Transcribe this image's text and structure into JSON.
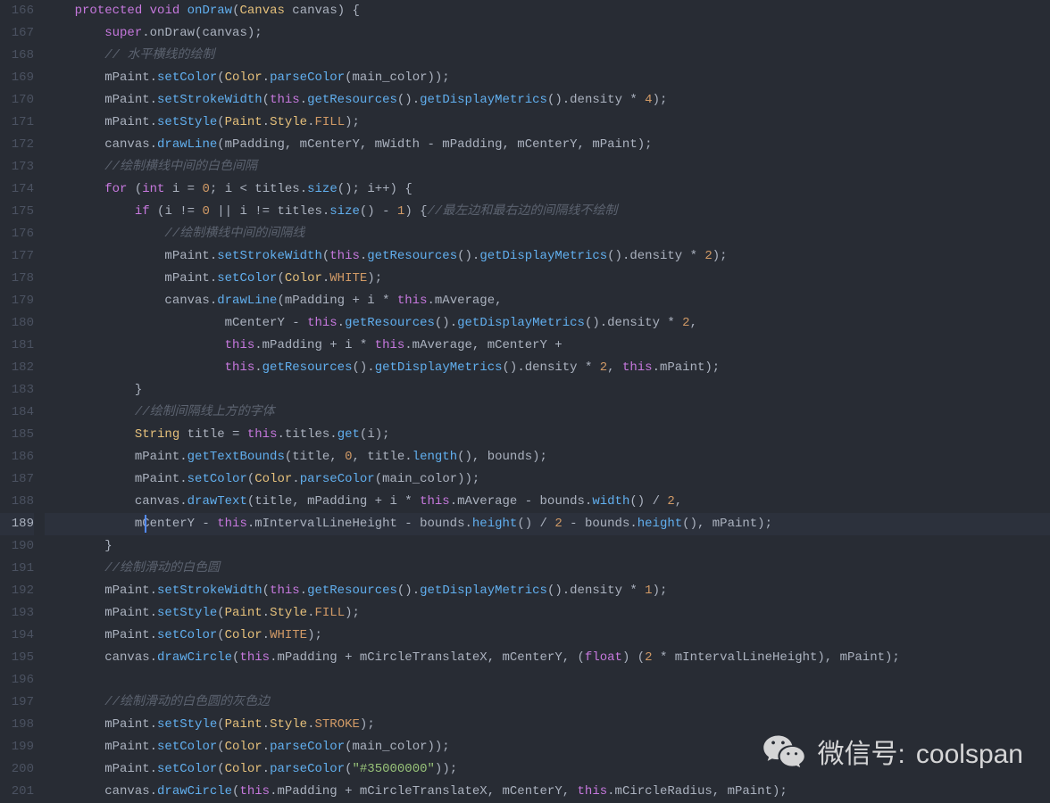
{
  "gutter": {
    "start": 166,
    "end": 201,
    "highlighted": 189
  },
  "code": {
    "lines": [
      [
        [
          "    ",
          ""
        ],
        [
          "protected",
          "kw"
        ],
        [
          " ",
          ""
        ],
        [
          "void",
          "kw"
        ],
        [
          " ",
          ""
        ],
        [
          "onDraw",
          "fn"
        ],
        [
          "(",
          ""
        ],
        [
          "Canvas",
          "type"
        ],
        [
          " canvas) {",
          ""
        ]
      ],
      [
        [
          "        ",
          ""
        ],
        [
          "super",
          "kw"
        ],
        [
          ".onDraw(canvas);",
          ""
        ]
      ],
      [
        [
          "        ",
          ""
        ],
        [
          "// 水平横线的绘制",
          "cm"
        ]
      ],
      [
        [
          "        mPaint.",
          ""
        ],
        [
          "setColor",
          "fn"
        ],
        [
          "(",
          ""
        ],
        [
          "Color",
          "type"
        ],
        [
          ".",
          ""
        ],
        [
          "parseColor",
          "fn"
        ],
        [
          "(main_color));",
          ""
        ]
      ],
      [
        [
          "        mPaint.",
          ""
        ],
        [
          "setStrokeWidth",
          "fn"
        ],
        [
          "(",
          ""
        ],
        [
          "this",
          "kw"
        ],
        [
          ".",
          ""
        ],
        [
          "getResources",
          "fn"
        ],
        [
          "().",
          ""
        ],
        [
          "getDisplayMetrics",
          "fn"
        ],
        [
          "().density * ",
          ""
        ],
        [
          "4",
          "num"
        ],
        [
          ");",
          ""
        ]
      ],
      [
        [
          "        mPaint.",
          ""
        ],
        [
          "setStyle",
          "fn"
        ],
        [
          "(",
          ""
        ],
        [
          "Paint",
          "type"
        ],
        [
          ".",
          ""
        ],
        [
          "Style",
          "type"
        ],
        [
          ".",
          ""
        ],
        [
          "FILL",
          "const"
        ],
        [
          ");",
          ""
        ]
      ],
      [
        [
          "        canvas.",
          ""
        ],
        [
          "drawLine",
          "fn"
        ],
        [
          "(mPadding, mCenterY, mWidth - mPadding, mCenterY, mPaint);",
          ""
        ]
      ],
      [
        [
          "        ",
          ""
        ],
        [
          "//绘制横线中间的白色间隔",
          "cm"
        ]
      ],
      [
        [
          "        ",
          ""
        ],
        [
          "for",
          "kw"
        ],
        [
          " (",
          ""
        ],
        [
          "int",
          "kw"
        ],
        [
          " i = ",
          ""
        ],
        [
          "0",
          "num"
        ],
        [
          "; i < titles.",
          ""
        ],
        [
          "size",
          "fn"
        ],
        [
          "(); i++) {",
          ""
        ]
      ],
      [
        [
          "            ",
          ""
        ],
        [
          "if",
          "kw"
        ],
        [
          " (i != ",
          ""
        ],
        [
          "0",
          "num"
        ],
        [
          " || i != titles.",
          ""
        ],
        [
          "size",
          "fn"
        ],
        [
          "() - ",
          ""
        ],
        [
          "1",
          "num"
        ],
        [
          ") {",
          ""
        ],
        [
          "//最左边和最右边的间隔线不绘制",
          "cm"
        ]
      ],
      [
        [
          "                ",
          ""
        ],
        [
          "//绘制横线中间的间隔线",
          "cm"
        ]
      ],
      [
        [
          "                mPaint.",
          ""
        ],
        [
          "setStrokeWidth",
          "fn"
        ],
        [
          "(",
          ""
        ],
        [
          "this",
          "kw"
        ],
        [
          ".",
          ""
        ],
        [
          "getResources",
          "fn"
        ],
        [
          "().",
          ""
        ],
        [
          "getDisplayMetrics",
          "fn"
        ],
        [
          "().density * ",
          ""
        ],
        [
          "2",
          "num"
        ],
        [
          ");",
          ""
        ]
      ],
      [
        [
          "                mPaint.",
          ""
        ],
        [
          "setColor",
          "fn"
        ],
        [
          "(",
          ""
        ],
        [
          "Color",
          "type"
        ],
        [
          ".",
          ""
        ],
        [
          "WHITE",
          "const"
        ],
        [
          ");",
          ""
        ]
      ],
      [
        [
          "                canvas.",
          ""
        ],
        [
          "drawLine",
          "fn"
        ],
        [
          "(mPadding + i * ",
          ""
        ],
        [
          "this",
          "kw"
        ],
        [
          ".mAverage,",
          ""
        ]
      ],
      [
        [
          "                        mCenterY - ",
          ""
        ],
        [
          "this",
          "kw"
        ],
        [
          ".",
          ""
        ],
        [
          "getResources",
          "fn"
        ],
        [
          "().",
          ""
        ],
        [
          "getDisplayMetrics",
          "fn"
        ],
        [
          "().density * ",
          ""
        ],
        [
          "2",
          "num"
        ],
        [
          ",",
          ""
        ]
      ],
      [
        [
          "                        ",
          ""
        ],
        [
          "this",
          "kw"
        ],
        [
          ".mPadding + i * ",
          ""
        ],
        [
          "this",
          "kw"
        ],
        [
          ".mAverage, mCenterY +",
          ""
        ]
      ],
      [
        [
          "                        ",
          ""
        ],
        [
          "this",
          "kw"
        ],
        [
          ".",
          ""
        ],
        [
          "getResources",
          "fn"
        ],
        [
          "().",
          ""
        ],
        [
          "getDisplayMetrics",
          "fn"
        ],
        [
          "().density * ",
          ""
        ],
        [
          "2",
          "num"
        ],
        [
          ", ",
          ""
        ],
        [
          "this",
          "kw"
        ],
        [
          ".mPaint);",
          ""
        ]
      ],
      [
        [
          "            }",
          ""
        ]
      ],
      [
        [
          "            ",
          ""
        ],
        [
          "//绘制间隔线上方的字体",
          "cm"
        ]
      ],
      [
        [
          "            ",
          ""
        ],
        [
          "String",
          "type"
        ],
        [
          " title = ",
          ""
        ],
        [
          "this",
          "kw"
        ],
        [
          ".titles.",
          ""
        ],
        [
          "get",
          "fn"
        ],
        [
          "(i);",
          ""
        ]
      ],
      [
        [
          "            mPaint.",
          ""
        ],
        [
          "getTextBounds",
          "fn"
        ],
        [
          "(title, ",
          ""
        ],
        [
          "0",
          "num"
        ],
        [
          ", title.",
          ""
        ],
        [
          "length",
          "fn"
        ],
        [
          "(), bounds);",
          ""
        ]
      ],
      [
        [
          "            mPaint.",
          ""
        ],
        [
          "setColor",
          "fn"
        ],
        [
          "(",
          ""
        ],
        [
          "Color",
          "type"
        ],
        [
          ".",
          ""
        ],
        [
          "parseColor",
          "fn"
        ],
        [
          "(main_color));",
          ""
        ]
      ],
      [
        [
          "            canvas.",
          ""
        ],
        [
          "drawText",
          "fn"
        ],
        [
          "(title, mPadding + i * ",
          ""
        ],
        [
          "this",
          "kw"
        ],
        [
          ".mAverage - bounds.",
          ""
        ],
        [
          "width",
          "fn"
        ],
        [
          "() / ",
          ""
        ],
        [
          "2",
          "num"
        ],
        [
          ",",
          ""
        ]
      ],
      [
        [
          "            mCenterY - ",
          ""
        ],
        [
          "this",
          "kw"
        ],
        [
          ".mIntervalLineHeight - bounds.",
          ""
        ],
        [
          "height",
          "fn"
        ],
        [
          "() / ",
          ""
        ],
        [
          "2",
          "num"
        ],
        [
          " - bounds.",
          ""
        ],
        [
          "height",
          "fn"
        ],
        [
          "(), mPaint);",
          ""
        ]
      ],
      [
        [
          "        }",
          ""
        ]
      ],
      [
        [
          "        ",
          ""
        ],
        [
          "//绘制滑动的白色圆",
          "cm"
        ]
      ],
      [
        [
          "        mPaint.",
          ""
        ],
        [
          "setStrokeWidth",
          "fn"
        ],
        [
          "(",
          ""
        ],
        [
          "this",
          "kw"
        ],
        [
          ".",
          ""
        ],
        [
          "getResources",
          "fn"
        ],
        [
          "().",
          ""
        ],
        [
          "getDisplayMetrics",
          "fn"
        ],
        [
          "().density * ",
          ""
        ],
        [
          "1",
          "num"
        ],
        [
          ");",
          ""
        ]
      ],
      [
        [
          "        mPaint.",
          ""
        ],
        [
          "setStyle",
          "fn"
        ],
        [
          "(",
          ""
        ],
        [
          "Paint",
          "type"
        ],
        [
          ".",
          ""
        ],
        [
          "Style",
          "type"
        ],
        [
          ".",
          ""
        ],
        [
          "FILL",
          "const"
        ],
        [
          ");",
          ""
        ]
      ],
      [
        [
          "        mPaint.",
          ""
        ],
        [
          "setColor",
          "fn"
        ],
        [
          "(",
          ""
        ],
        [
          "Color",
          "type"
        ],
        [
          ".",
          ""
        ],
        [
          "WHITE",
          "const"
        ],
        [
          ");",
          ""
        ]
      ],
      [
        [
          "        canvas.",
          ""
        ],
        [
          "drawCircle",
          "fn"
        ],
        [
          "(",
          ""
        ],
        [
          "this",
          "kw"
        ],
        [
          ".mPadding + mCircleTranslateX, mCenterY, (",
          ""
        ],
        [
          "float",
          "kw"
        ],
        [
          ") (",
          ""
        ],
        [
          "2",
          "num"
        ],
        [
          " * mIntervalLineHeight), mPaint);",
          ""
        ]
      ],
      [
        [
          "",
          ""
        ]
      ],
      [
        [
          "        ",
          ""
        ],
        [
          "//绘制滑动的白色圆的灰色边",
          "cm"
        ]
      ],
      [
        [
          "        mPaint.",
          ""
        ],
        [
          "setStyle",
          "fn"
        ],
        [
          "(",
          ""
        ],
        [
          "Paint",
          "type"
        ],
        [
          ".",
          ""
        ],
        [
          "Style",
          "type"
        ],
        [
          ".",
          ""
        ],
        [
          "STROKE",
          "const"
        ],
        [
          ");",
          ""
        ]
      ],
      [
        [
          "        mPaint.",
          ""
        ],
        [
          "setColor",
          "fn"
        ],
        [
          "(",
          ""
        ],
        [
          "Color",
          "type"
        ],
        [
          ".",
          ""
        ],
        [
          "parseColor",
          "fn"
        ],
        [
          "(main_color));",
          ""
        ]
      ],
      [
        [
          "        mPaint.",
          ""
        ],
        [
          "setColor",
          "fn"
        ],
        [
          "(",
          ""
        ],
        [
          "Color",
          "type"
        ],
        [
          ".",
          ""
        ],
        [
          "parseColor",
          "fn"
        ],
        [
          "(",
          ""
        ],
        [
          "\"#35000000\"",
          "str"
        ],
        [
          "));",
          ""
        ]
      ],
      [
        [
          "        canvas.",
          ""
        ],
        [
          "drawCircle",
          "fn"
        ],
        [
          "(",
          ""
        ],
        [
          "this",
          "kw"
        ],
        [
          ".mPadding + mCircleTranslateX, mCenterY, ",
          ""
        ],
        [
          "this",
          "kw"
        ],
        [
          ".mCircleRadius, mPaint);",
          ""
        ]
      ]
    ],
    "cursorLineIndex": 23,
    "cursorColPx": 112
  },
  "watermark": {
    "prefix": "微信号:",
    "id": "coolspan"
  }
}
